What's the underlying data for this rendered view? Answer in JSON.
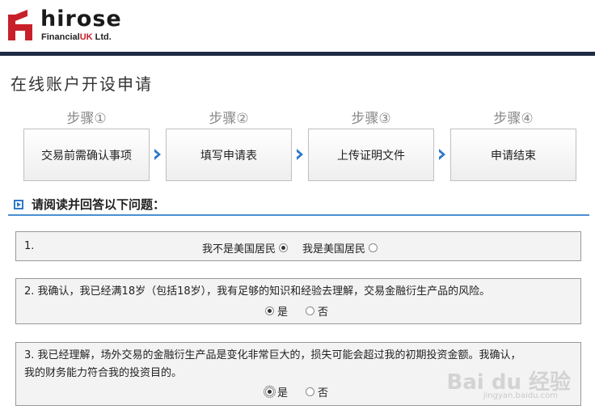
{
  "brand": {
    "name": "hirose",
    "sub_prefix": "Financial",
    "sub_uk": "UK",
    "sub_suffix": " Ltd."
  },
  "page": {
    "title": "在线账户开设申请"
  },
  "steps": [
    {
      "label": "步骤①",
      "name": "交易前需确认事项"
    },
    {
      "label": "步骤②",
      "name": "填写申请表"
    },
    {
      "label": "步骤③",
      "name": "上传证明文件"
    },
    {
      "label": "步骤④",
      "name": "申请结束"
    }
  ],
  "section": {
    "heading": "请阅读并回答以下问题："
  },
  "questions": [
    {
      "number": "1.",
      "text": "",
      "options": [
        {
          "label": "我不是美国居民",
          "selected": true
        },
        {
          "label": "我是美国居民",
          "selected": false
        }
      ]
    },
    {
      "number": "2.",
      "text": "我确认，我已经满18岁（包括18岁），我有足够的知识和经验去理解，交易金融衍生产品的风险。",
      "options": [
        {
          "label": "是",
          "selected": true
        },
        {
          "label": "否",
          "selected": false
        }
      ]
    },
    {
      "number": "3.",
      "text_line1": "我已经理解，场外交易的金融衍生产品是变化非常巨大的，损失可能会超过我的初期投资金额。我确认，",
      "text_line2": "我的财务能力符合我的投资目的。",
      "options": [
        {
          "label": "是",
          "selected": true
        },
        {
          "label": "否",
          "selected": false
        }
      ]
    }
  ],
  "watermark": {
    "text": "Bai du 经验",
    "sub": "jingyan.baidu.com"
  },
  "colors": {
    "brand_red": "#c8202a",
    "topbar": "#1f2a44",
    "accent_blue": "#2d78c8"
  }
}
